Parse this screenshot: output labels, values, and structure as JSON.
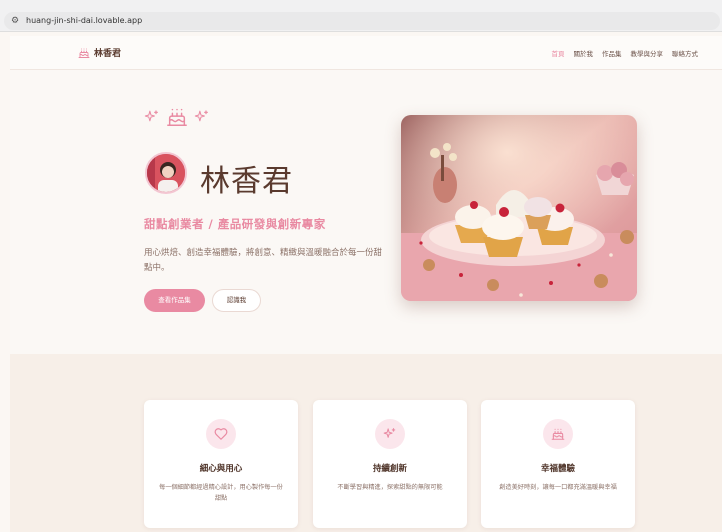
{
  "browser": {
    "url": "huang-jin-shi-dai.lovable.app",
    "site_icon": "site-settings-icon"
  },
  "nav": {
    "brand_name": "林香君",
    "brand_icon": "cake-icon",
    "items": [
      {
        "label": "首頁",
        "active": true
      },
      {
        "label": "關於我",
        "active": false
      },
      {
        "label": "作品集",
        "active": false
      },
      {
        "label": "教學與分享",
        "active": false
      },
      {
        "label": "聯絡方式",
        "active": false
      }
    ]
  },
  "hero": {
    "icons": [
      "sparkles-icon",
      "cake-icon",
      "sparkles-icon"
    ],
    "name": "林香君",
    "subtitle": "甜點創業者 / 產品研發與創新專家",
    "description": "用心烘焙、創造幸福體驗，將創意、精緻與溫暖融合於每一份甜點中。",
    "primary_button": "查看作品集",
    "secondary_button": "認識我"
  },
  "features": [
    {
      "icon": "heart-icon",
      "title": "細心與用心",
      "desc": "每一個細節都經過精心設計，用心製作每一份甜點"
    },
    {
      "icon": "sparkles-icon",
      "title": "持續創新",
      "desc": "不斷學習與精進，探索甜點的無限可能"
    },
    {
      "icon": "cake-icon",
      "title": "幸福體驗",
      "desc": "創造美好時刻，讓每一口都充滿溫暖與幸福"
    }
  ],
  "colors": {
    "accent": "#e98aa2",
    "text_dark": "#5a3a2e",
    "background": "#fbf8f5",
    "features_bg": "#f7efe8"
  }
}
